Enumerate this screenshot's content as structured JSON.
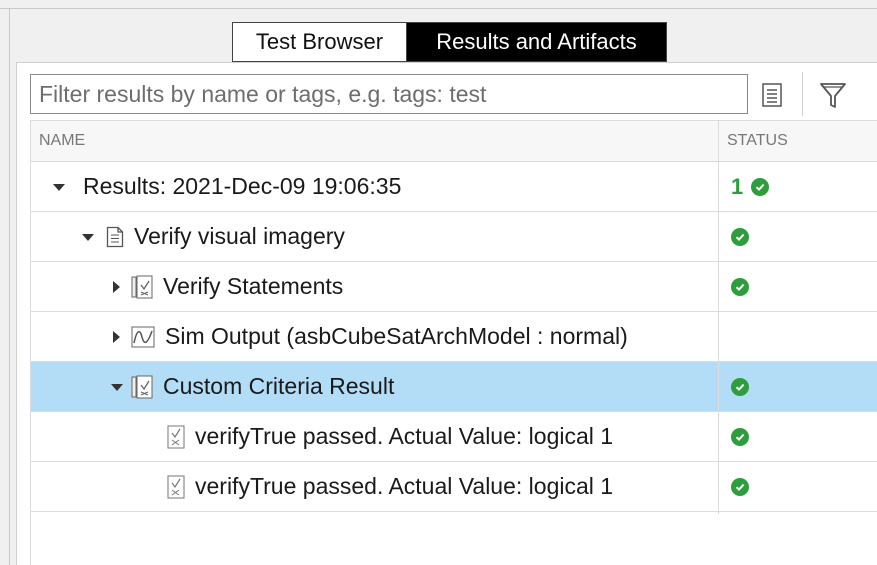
{
  "tabs": [
    {
      "label": "Test Browser",
      "active": false
    },
    {
      "label": "Results and Artifacts",
      "active": true
    }
  ],
  "filter": {
    "placeholder": "Filter results by name or tags, e.g. tags: test",
    "value": ""
  },
  "columns": {
    "name": "NAME",
    "status": "STATUS"
  },
  "colors": {
    "pass": "#2e9e3c",
    "selected_row": "#b3dcf7"
  },
  "rows": [
    {
      "label": "Results: 2021-Dec-09 19:06:35",
      "expanded": true,
      "icon": "none",
      "count": "1",
      "status": "passed"
    },
    {
      "label": "Verify visual imagery",
      "expanded": true,
      "icon": "document-icon",
      "status": "passed"
    },
    {
      "label": "Verify Statements",
      "expanded": false,
      "icon": "criteria-icon",
      "status": "passed"
    },
    {
      "label": "Sim Output (asbCubeSatArchModel : normal)",
      "expanded": false,
      "icon": "signal-icon",
      "status": ""
    },
    {
      "label": "Custom Criteria Result",
      "expanded": true,
      "icon": "criteria-icon",
      "status": "passed",
      "selected": true
    },
    {
      "label": "verifyTrue passed. Actual Value: logical 1",
      "icon": "assessment-icon",
      "status": "passed"
    },
    {
      "label": "verifyTrue passed. Actual Value: logical 1",
      "icon": "assessment-icon",
      "status": "passed"
    }
  ]
}
